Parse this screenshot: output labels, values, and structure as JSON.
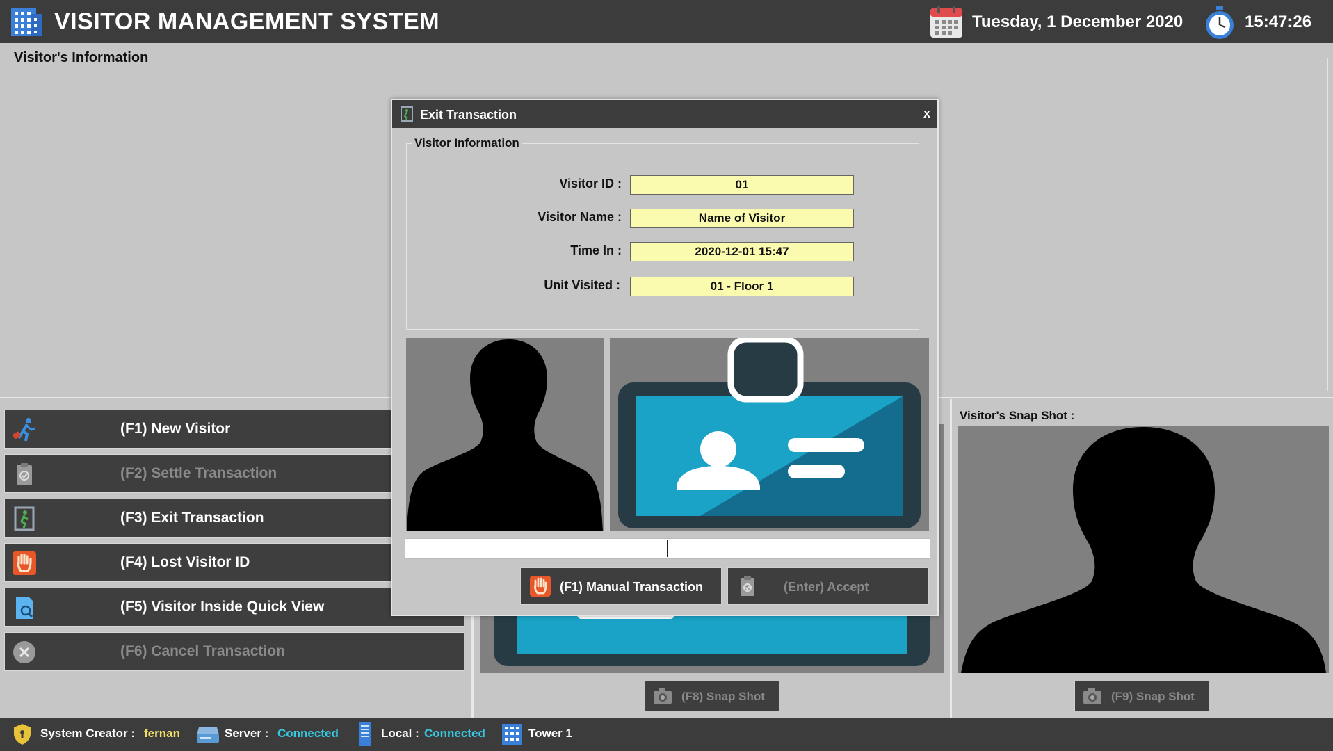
{
  "header": {
    "title": "VISITOR MANAGEMENT SYSTEM",
    "date": "Tuesday, 1 December 2020",
    "time": "15:47:26"
  },
  "visitor_info_group": {
    "title": "Visitor's Information"
  },
  "menu": [
    {
      "label": "(F1) New Visitor",
      "enabled": true,
      "icon": "walking-visitor-icon"
    },
    {
      "label": "(F2) Settle Transaction",
      "enabled": false,
      "icon": "clipboard-icon"
    },
    {
      "label": "(F3) Exit Transaction",
      "enabled": true,
      "icon": "exit-door-icon"
    },
    {
      "label": "(F4) Lost Visitor ID",
      "enabled": true,
      "icon": "hand-stop-icon"
    },
    {
      "label": "(F5) Visitor Inside Quick View",
      "enabled": true,
      "icon": "document-search-icon"
    },
    {
      "label": "(F6) Cancel Transaction",
      "enabled": false,
      "icon": "cancel-icon"
    }
  ],
  "snap_buttons": {
    "f8": "(F8) Snap Shot",
    "f9": "(F9) Snap Shot"
  },
  "snapshot_panel": {
    "title": "Visitor's Snap Shot :"
  },
  "footer": {
    "creator_label": "System Creator :",
    "creator_value": "fernan",
    "server_label": "Server :",
    "server_value": "Connected",
    "local_label": "Local :",
    "local_value": "Connected",
    "tower": "Tower 1"
  },
  "modal": {
    "title": "Exit Transaction",
    "close": "x",
    "group_title": "Visitor Information",
    "fields": [
      {
        "label": "Visitor ID :",
        "value": "01"
      },
      {
        "label": "Visitor Name :",
        "value": "Name of Visitor"
      },
      {
        "label": "Time In :",
        "value": "2020-12-01 15:47"
      },
      {
        "label": "Unit Visited :",
        "value": "01 - Floor 1"
      }
    ],
    "manual_button": "(F1) Manual Transaction",
    "accept_button": "(Enter) Accept"
  },
  "colors": {
    "dark_bar": "#3c3c3c",
    "background": "#c6c6c6",
    "field_yellow": "#fbfbb0",
    "id_card_blue": "#1aa3c6",
    "connected_cyan": "#36c9e0",
    "creator_yellow": "#f2e26a"
  }
}
